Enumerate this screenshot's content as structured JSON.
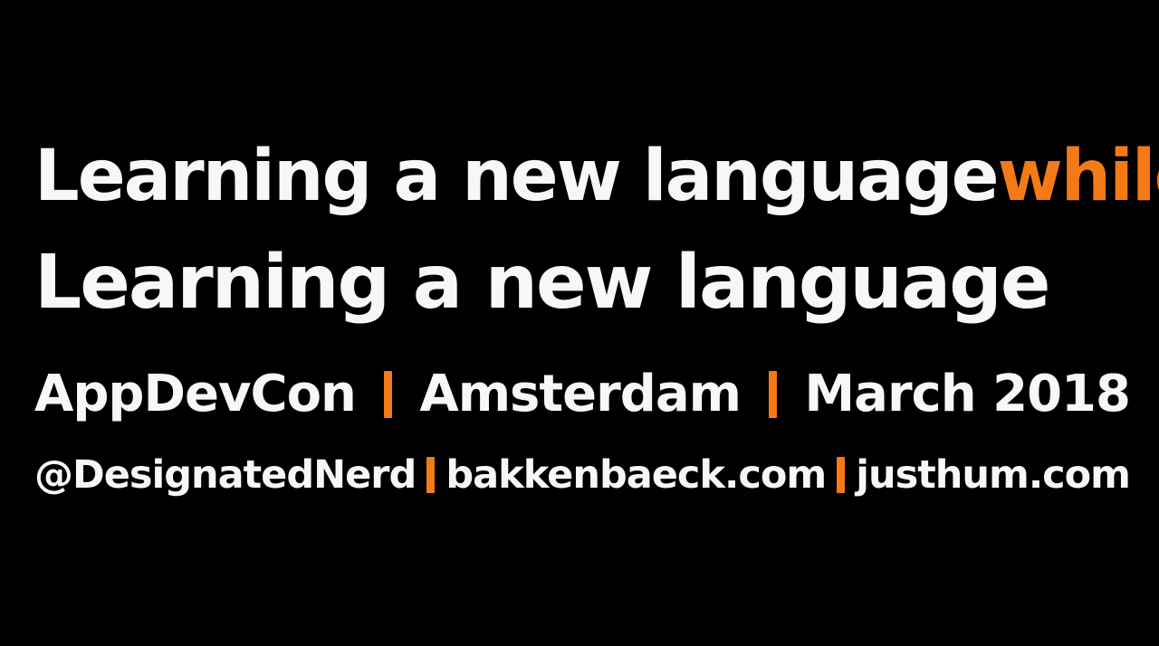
{
  "slide": {
    "title_line_1": "Learning a new language",
    "title_line_1_accent": "while",
    "title_line_2": "Learning a new language",
    "event": {
      "name": "AppDevCon",
      "city": "Amsterdam",
      "date": "March 2018"
    },
    "links": {
      "handle": "@DesignatedNerd",
      "site_1": "bakkenbaeck.com",
      "site_2": "justhum.com"
    }
  },
  "colors": {
    "background": "#000000",
    "text": "#f7f7f7",
    "accent": "#f47a16"
  }
}
